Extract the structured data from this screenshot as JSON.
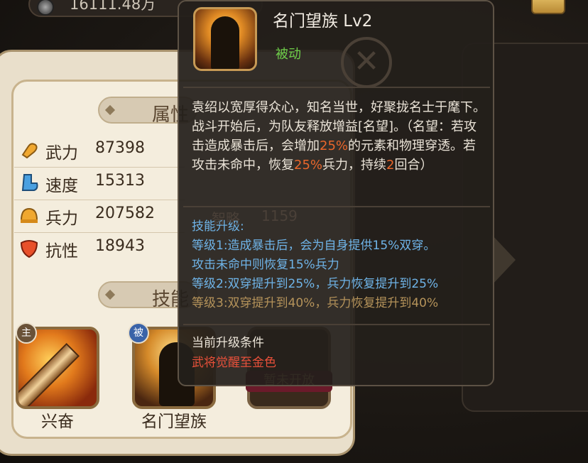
{
  "top_bar": {
    "money": "16111.48万"
  },
  "attributes": {
    "section_title": "属性",
    "stats": [
      {
        "name": "武力",
        "value": "87398",
        "icon": "fist-icon"
      },
      {
        "name": "速度",
        "value": "15313",
        "icon": "boot-icon"
      },
      {
        "name": "兵力",
        "value": "207582",
        "icon": "helmet-icon"
      },
      {
        "name": "抗性",
        "value": "18943",
        "icon": "shield-icon"
      }
    ],
    "ghost_stat": {
      "name": "智略",
      "value": "1159"
    }
  },
  "skills": {
    "section_title": "技能",
    "slots": [
      {
        "badge": "主",
        "name": "兴奋"
      },
      {
        "badge": "被",
        "name": "名门望族"
      },
      {
        "badge": "",
        "name": "",
        "locked": "暂未开放"
      }
    ]
  },
  "tooltip": {
    "title": "名门望族 Lv2",
    "type": "被动",
    "description": {
      "line1": "袁绍以宽厚得众心，知名当世，好聚拢名士于麾下。战斗开始后，为队友释放增益[名望]。（名望：若攻击造成暴击后，会增加",
      "pct1": "25%",
      "line2": "的元素和物理穿透。若攻击未命中，恢复",
      "pct2": "25%",
      "line3": "兵力，持续",
      "turns": "2",
      "line4": "回合）"
    },
    "upgrade": {
      "header": "技能升级:",
      "level1a": "等级1:造成暴击后，会为自身提供15%双穿。",
      "level1b": "攻击未命中则恢复15%兵力",
      "level2": "等级2:双穿提升到25%，兵力恢复提升到25%",
      "level3": "等级3:双穿提升到40%，兵力恢复提升到40%"
    },
    "condition": {
      "header": "当前升级条件",
      "text": "武将觉醒至金色"
    }
  },
  "colors": {
    "highlight": "#e9662b",
    "passive": "#6fcf4a",
    "upgrade_active": "#6fb4e8",
    "upgrade_locked": "#b5935a",
    "condition": "#e8503a"
  }
}
